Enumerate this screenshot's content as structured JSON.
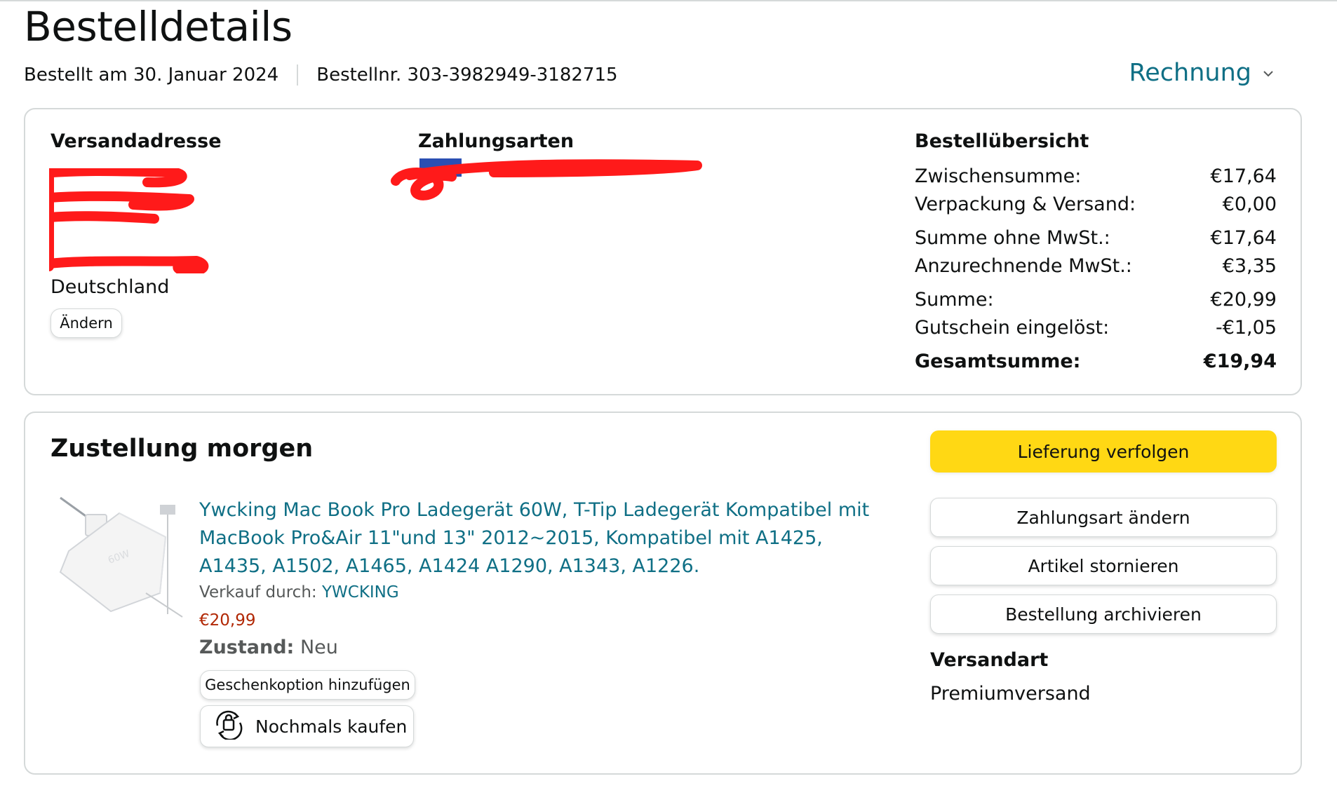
{
  "header": {
    "title": "Bestelldetails",
    "order_date": "Bestellt am 30. Januar 2024",
    "order_number": "Bestellnr. 303-3982949-3182715",
    "invoice_label": "Rechnung"
  },
  "shipping": {
    "title": "Versandadresse",
    "country": "Deutschland",
    "change_button": "Ändern"
  },
  "payment": {
    "title": "Zahlungsarten"
  },
  "summary": {
    "title": "Bestellübersicht",
    "rows": [
      {
        "label": "Zwischensumme:",
        "value": "€17,64"
      },
      {
        "label": "Verpackung & Versand:",
        "value": "€0,00"
      },
      {
        "label": "Summe ohne MwSt.:",
        "value": "€17,64"
      },
      {
        "label": "Anzurechnende MwSt.:",
        "value": "€3,35"
      },
      {
        "label": "Summe:",
        "value": "€20,99"
      },
      {
        "label": "Gutschein eingelöst:",
        "value": "-€1,05"
      }
    ],
    "total_label": "Gesamtsumme:",
    "total_value": "€19,94"
  },
  "delivery": {
    "title": "Zustellung morgen",
    "product_title": "Ywcking Mac Book Pro Ladegerät 60W, T-Tip Ladegerät Kompatibel mit MacBook Pro&Air 11\"und 13\" 2012~2015, Kompatibel mit A1425, A1435, A1502, A1465, A1424 A1290, A1343, A1226.",
    "seller_prefix": "Verkauf durch:",
    "seller_name": "YWCKING",
    "price": "€20,99",
    "condition_label": "Zustand:",
    "condition_value": "Neu",
    "gift_button": "Geschenkoption hinzufügen",
    "rebuy_button": "Nochmals kaufen",
    "product_image_text": "60W"
  },
  "actions": {
    "track": "Lieferung verfolgen",
    "change_payment": "Zahlungsart ändern",
    "cancel_item": "Artikel stornieren",
    "archive_order": "Bestellung archivieren",
    "shipping_method_label": "Versandart",
    "shipping_method_value": "Premiumversand"
  },
  "colors": {
    "link": "#0f6f85",
    "price": "#b12704",
    "primary_button": "#ffd814",
    "redaction": "#ff1a1a"
  }
}
